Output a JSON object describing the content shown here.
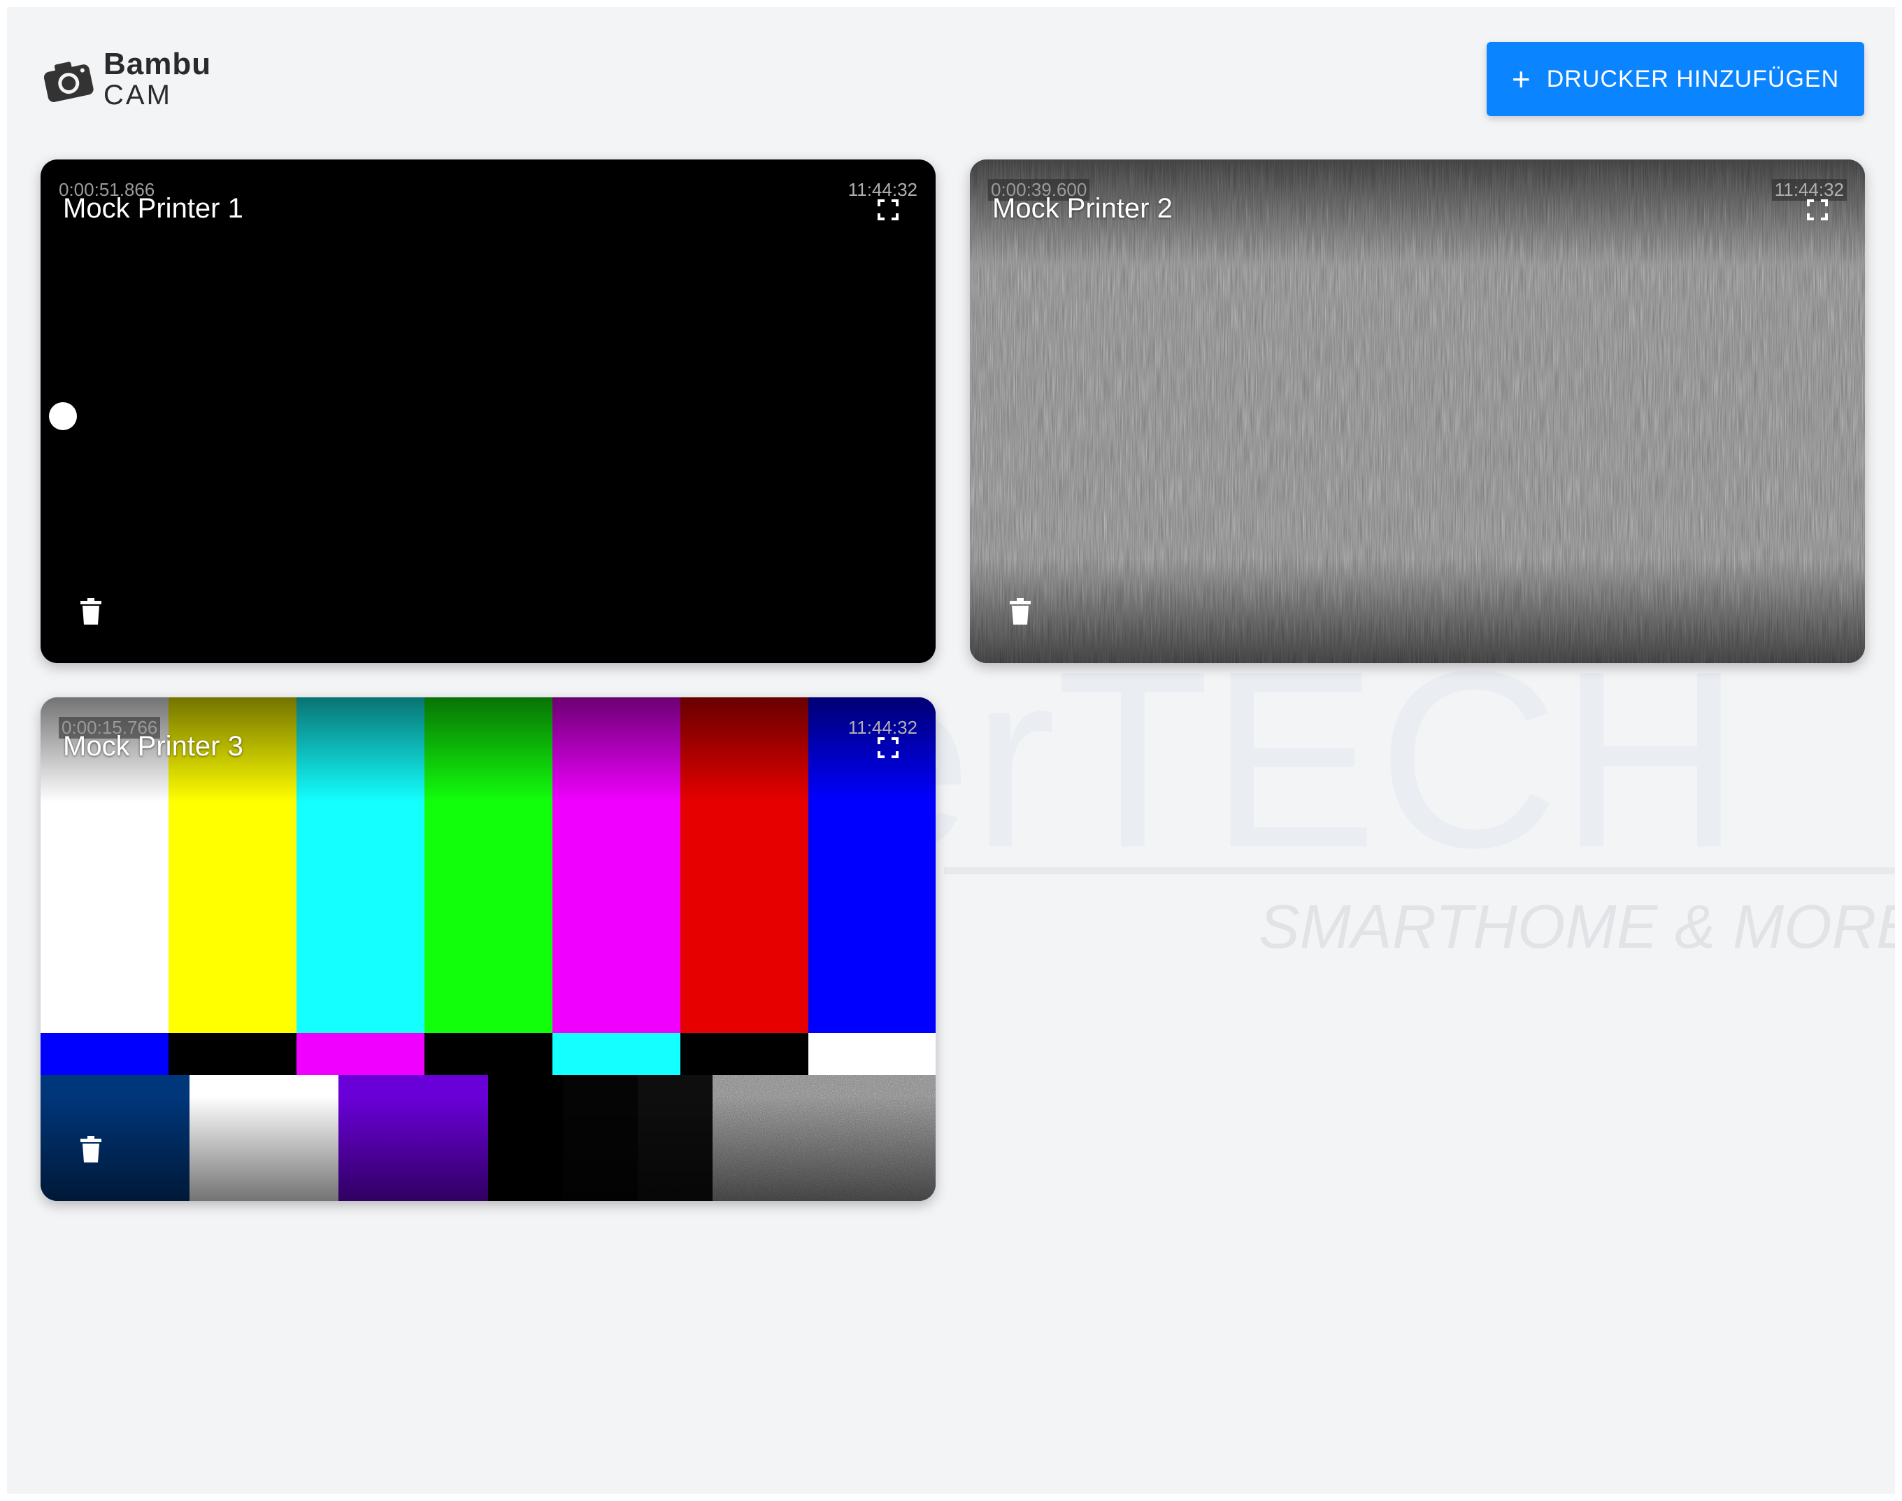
{
  "app": {
    "logo_brand": "Bambu",
    "logo_sub": "CAM"
  },
  "header": {
    "add_printer_label": "DRUCKER HINZUFÜGEN",
    "add_icon": "plus-icon"
  },
  "watermark": {
    "text_main": "erTECH",
    "text_sub": "SMARTHOME & MORE"
  },
  "printers": [
    {
      "name": "Mock Printer 1",
      "elapsed": "0:00:51.866",
      "clock": "11:44:32",
      "feed": "black-with-moving-dot"
    },
    {
      "name": "Mock Printer 2",
      "elapsed": "0:00:39.600",
      "clock": "11:44:32",
      "feed": "gray-static-noise"
    },
    {
      "name": "Mock Printer 3",
      "elapsed": "0:00:15.766",
      "clock": "11:44:32",
      "feed": "smpte-color-bars"
    }
  ],
  "icons": {
    "fullscreen": "fullscreen-icon",
    "delete": "trash-icon",
    "camera": "camera-icon"
  },
  "colors": {
    "accent": "#0a84ff",
    "background": "#f3f4f6"
  }
}
